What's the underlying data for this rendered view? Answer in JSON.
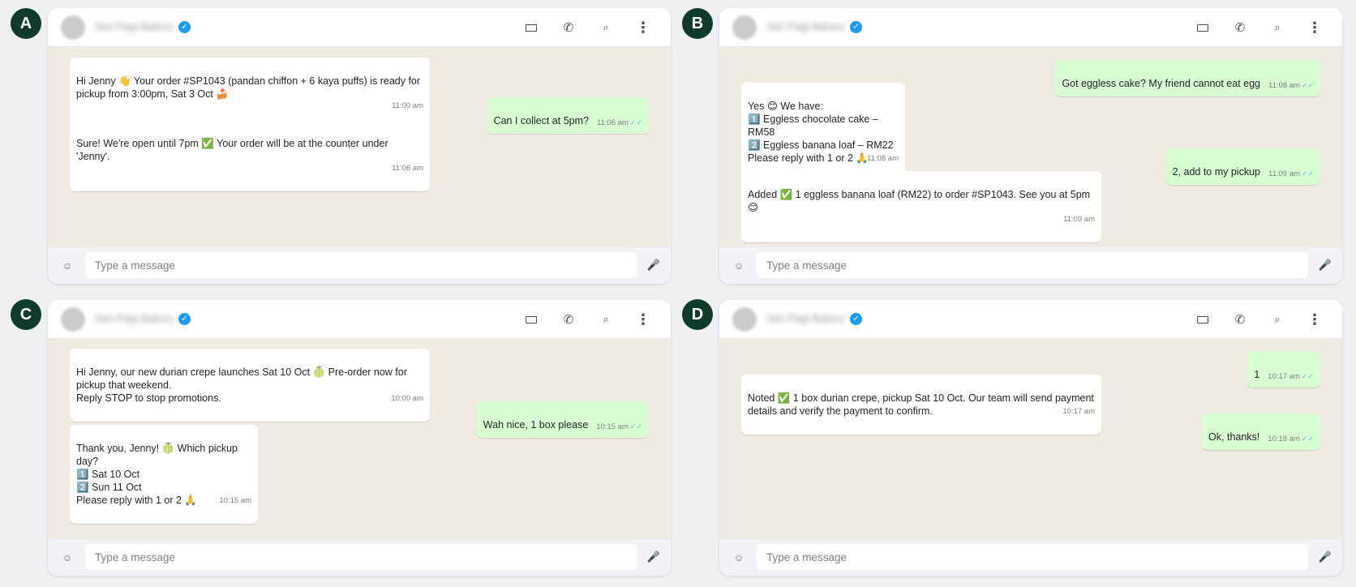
{
  "panels": {
    "A": {
      "badge": "A",
      "header": {
        "contact_name": "Sari Pagi Bakery",
        "verified": "✓"
      },
      "input_placeholder": "Type a message",
      "messages": [
        {
          "dir": "in",
          "text": "Hi Jenny 👋 Your order #SP1043 (pandan chiffon + 6 kaya puffs) is ready for pickup from 3:00pm, Sat 3 Oct 🍰",
          "time": "11:00 am"
        },
        {
          "dir": "out",
          "text": "Can I collect at 5pm?",
          "time": "11:06 am",
          "ticks": "✓✓"
        },
        {
          "dir": "in",
          "text": "Sure! We're open until 7pm ✅ Your order will be at the counter under 'Jenny'.",
          "time": "11:06 am"
        }
      ]
    },
    "B": {
      "badge": "B",
      "header": {
        "contact_name": "Sari Pagi Bakery",
        "verified": "✓"
      },
      "input_placeholder": "Type a message",
      "messages": [
        {
          "dir": "out",
          "text": "Got eggless cake? My friend cannot eat egg",
          "time": "11:08 am",
          "ticks": "✓✓"
        },
        {
          "dir": "in",
          "text": "Yes 😊 We have:\n1️⃣ Eggless chocolate cake – RM58\n2️⃣ Eggless banana loaf – RM22\nPlease reply with 1 or 2 🙏",
          "time": "11:08 am"
        },
        {
          "dir": "out",
          "text": "2, add to my pickup",
          "time": "11:09 am",
          "ticks": "✓✓"
        },
        {
          "dir": "in",
          "text": "Added ✅ 1 eggless banana loaf (RM22) to order #SP1043. See you at 5pm 😊",
          "time": "11:09 am"
        }
      ]
    },
    "C": {
      "badge": "C",
      "header": {
        "contact_name": "Sari Pagi Bakery",
        "verified": "✓"
      },
      "input_placeholder": "Type a message",
      "messages": [
        {
          "dir": "in",
          "text": "Hi Jenny, our new durian crepe launches Sat 10 Oct 🍈 Pre-order now for pickup that weekend.\nReply STOP to stop promotions.",
          "time": "10:00 am"
        },
        {
          "dir": "out",
          "text": "Wah nice, 1 box please",
          "time": "10:15 am",
          "ticks": "✓✓"
        },
        {
          "dir": "in",
          "text": "Thank you, Jenny! 🍈 Which pickup day?\n1️⃣ Sat 10 Oct\n2️⃣ Sun 11 Oct\nPlease reply with 1 or 2 🙏",
          "time": "10:15 am"
        }
      ]
    },
    "D": {
      "badge": "D",
      "header": {
        "contact_name": "Sari Pagi Bakery",
        "verified": "✓"
      },
      "input_placeholder": "Type a message",
      "messages": [
        {
          "dir": "out",
          "text": "1",
          "time": "10:17 am",
          "ticks": "✓✓"
        },
        {
          "dir": "in",
          "text": "Noted ✅ 1 box durian crepe, pickup Sat 10 Oct. Our team will send payment details and verify the payment to confirm.",
          "time": "10:17 am"
        },
        {
          "dir": "out",
          "text": "Ok, thanks!",
          "time": "10:18 am",
          "ticks": "✓✓"
        }
      ]
    }
  },
  "icons": {
    "header": [
      "video-icon",
      "phone-icon",
      "search-icon",
      "more-vertical-icon"
    ],
    "footer": [
      "emoji-icon",
      "microphone-icon"
    ]
  }
}
